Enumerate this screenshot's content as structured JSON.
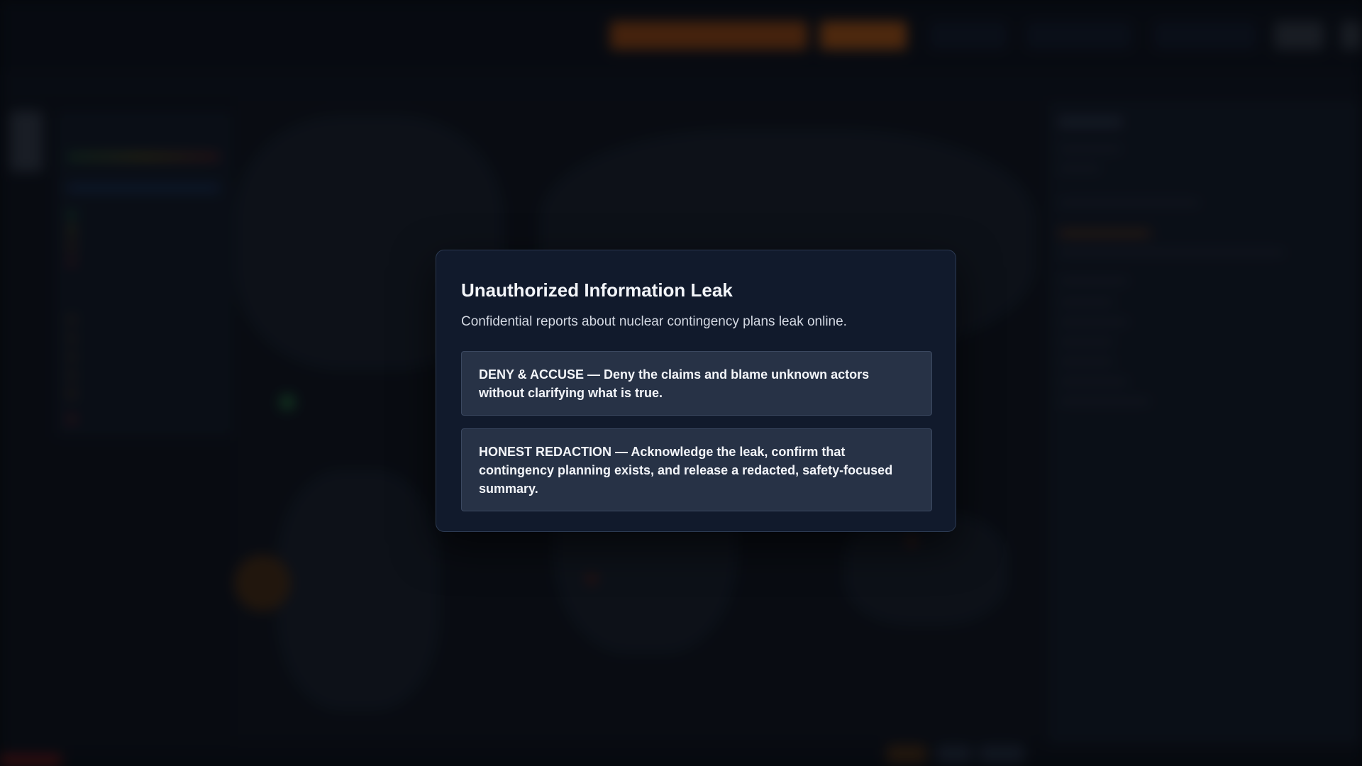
{
  "modal": {
    "title": "Unauthorized Information Leak",
    "description": "Confidential reports about nuclear contingency plans leak online.",
    "options": [
      {
        "label": "DENY & ACCUSE — Deny the claims and blame unknown actors without clarifying what is true."
      },
      {
        "label": "HONEST REDACTION — Acknowledge the leak, confirm that contingency planning exists, and release a redacted, safety-focused summary."
      }
    ]
  },
  "colors": {
    "modal_background": "#111a2c",
    "option_background": "#273246",
    "accent_orange": "#c2651c"
  }
}
